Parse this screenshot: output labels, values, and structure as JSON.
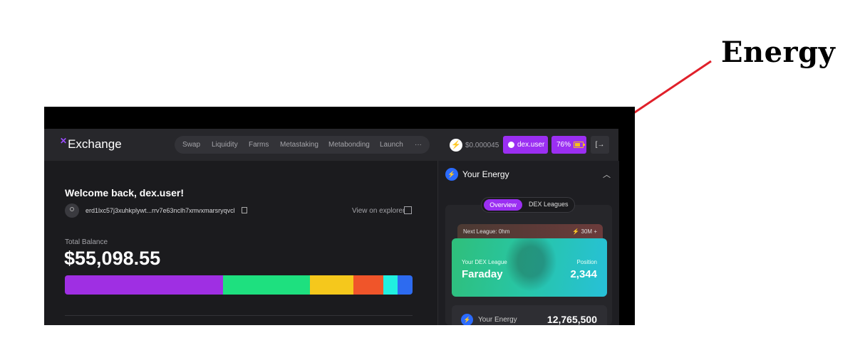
{
  "annotation": {
    "title": "Energy",
    "color": "#e0202a"
  },
  "app": {
    "logo_text": "Exchange",
    "nav_items": [
      "Swap",
      "Liquidity",
      "Farms",
      "Metastaking",
      "Metabonding",
      "Launch",
      "···"
    ],
    "price": "$0.000045",
    "user_label": "dex.user",
    "energy_percent": "76%",
    "logout_icon": "logout-icon",
    "accent": "#9b2ff2"
  },
  "account": {
    "welcome": "Welcome back, dex.user!",
    "address": "erd1lxc57j3xuhkplywt...rrv7e63nclh7xmvxmarsryqvcl",
    "explorer_link": "View on explorer",
    "balance_label": "Total Balance",
    "balance_value": "$55,098.55",
    "allocation": [
      {
        "color": "#9f2fe3",
        "share": 0.455
      },
      {
        "color": "#1ee07f",
        "share": 0.25
      },
      {
        "color": "#f5c81c",
        "share": 0.125
      },
      {
        "color": "#f0552a",
        "share": 0.085
      },
      {
        "color": "#21f0e0",
        "share": 0.043
      },
      {
        "color": "#2d6bf0",
        "share": 0.042
      }
    ]
  },
  "energy_panel": {
    "title": "Your Energy",
    "tabs": [
      "Overview",
      "DEX Leagues"
    ],
    "next_league": "Next League: 0hm",
    "next_league_req": "30M +",
    "league_label": "Your DEX League",
    "league_name": "Faraday",
    "position_label": "Position",
    "position_value": "2,344",
    "energy_label": "Your Energy",
    "energy_value": "12,765,500"
  }
}
